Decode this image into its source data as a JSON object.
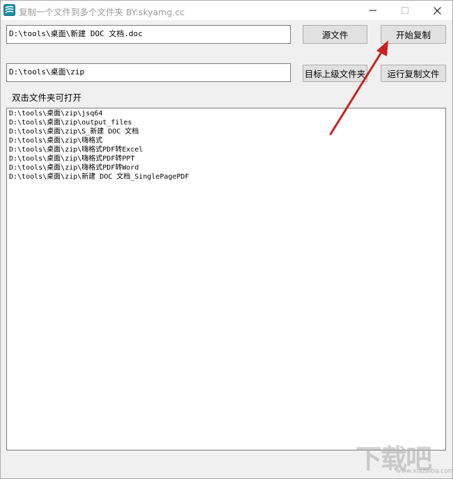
{
  "window": {
    "title": "复制一个文件到多个文件夹   BY:skyamg.cc"
  },
  "source": {
    "path": "D:\\tools\\桌面\\新建 DOC 文档.doc",
    "button_label": "源文件"
  },
  "start_button_label": "开始复制",
  "target": {
    "path": "D:\\tools\\桌面\\zip",
    "button_label": "目标上级文件夹"
  },
  "run_button_label": "运行复制文件",
  "list_hint": "双击文件夹可打开",
  "folders": [
    "D:\\tools\\桌面\\zip\\jsq64",
    "D:\\tools\\桌面\\zip\\output_files",
    "D:\\tools\\桌面\\zip\\S_新建 DOC 文档",
    "D:\\tools\\桌面\\zip\\嗨格式",
    "D:\\tools\\桌面\\zip\\嗨格式PDF转Excel",
    "D:\\tools\\桌面\\zip\\嗨格式PDF转PPT",
    "D:\\tools\\桌面\\zip\\嗨格式PDF转Word",
    "D:\\tools\\桌面\\zip\\新建 DOC 文档_SinglePagePDF"
  ],
  "watermark": {
    "text": "下载吧",
    "url": "www.xiazaiba.com"
  },
  "icons": {
    "app": "app-logo-icon",
    "minimize": "minimize-icon",
    "maximize": "maximize-icon",
    "close": "close-icon",
    "annotation": "red-arrow-annotation"
  },
  "colors": {
    "arrow": "#cc1f1f",
    "title_text": "#9a9a9a",
    "button_face": "#e1e1e1"
  }
}
